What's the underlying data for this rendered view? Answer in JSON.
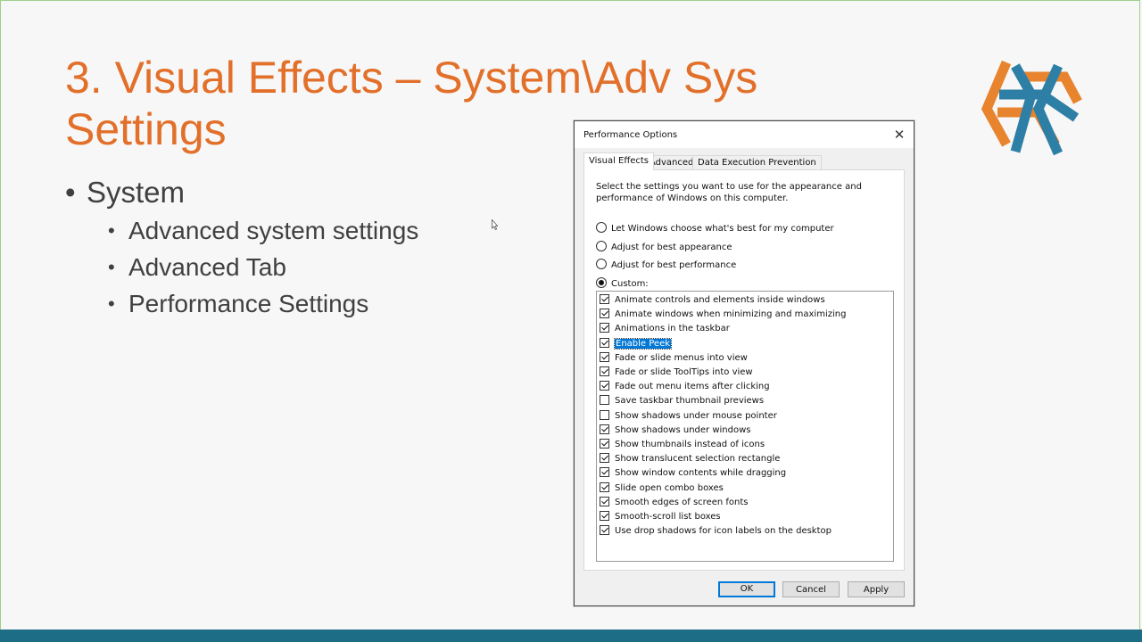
{
  "slide": {
    "title": "3. Visual Effects – System\\Adv Sys Settings",
    "bullet": "System",
    "sub_bullets": [
      "Advanced system settings",
      "Advanced Tab",
      "Performance Settings"
    ]
  },
  "colors": {
    "title": "#e2702a",
    "bar": "#1e6d86",
    "selection": "#0078d7"
  },
  "dialog": {
    "title": "Performance Options",
    "close_glyph": "✕",
    "tabs": [
      {
        "label": "Visual Effects",
        "active": true
      },
      {
        "label": "Advanced",
        "active": false
      },
      {
        "label": "Data Execution Prevention",
        "active": false
      }
    ],
    "description": "Select the settings you want to use for the appearance and performance of Windows on this computer.",
    "radios": [
      {
        "label": "Let Windows choose what's best for my computer",
        "checked": false
      },
      {
        "label": "Adjust for best appearance",
        "checked": false
      },
      {
        "label": "Adjust for best performance",
        "checked": false
      },
      {
        "label": "Custom:",
        "checked": true
      }
    ],
    "effects": [
      {
        "label": "Animate controls and elements inside windows",
        "checked": true
      },
      {
        "label": "Animate windows when minimizing and maximizing",
        "checked": true
      },
      {
        "label": "Animations in the taskbar",
        "checked": true
      },
      {
        "label": "Enable Peek",
        "checked": true,
        "selected": true
      },
      {
        "label": "Fade or slide menus into view",
        "checked": true
      },
      {
        "label": "Fade or slide ToolTips into view",
        "checked": true
      },
      {
        "label": "Fade out menu items after clicking",
        "checked": true
      },
      {
        "label": "Save taskbar thumbnail previews",
        "checked": false
      },
      {
        "label": "Show shadows under mouse pointer",
        "checked": false
      },
      {
        "label": "Show shadows under windows",
        "checked": true
      },
      {
        "label": "Show thumbnails instead of icons",
        "checked": true
      },
      {
        "label": "Show translucent selection rectangle",
        "checked": true
      },
      {
        "label": "Show window contents while dragging",
        "checked": true
      },
      {
        "label": "Slide open combo boxes",
        "checked": true
      },
      {
        "label": "Smooth edges of screen fonts",
        "checked": true
      },
      {
        "label": "Smooth-scroll list boxes",
        "checked": true
      },
      {
        "label": "Use drop shadows for icon labels on the desktop",
        "checked": true
      }
    ],
    "buttons": {
      "ok": "OK",
      "cancel": "Cancel",
      "apply": "Apply"
    }
  }
}
